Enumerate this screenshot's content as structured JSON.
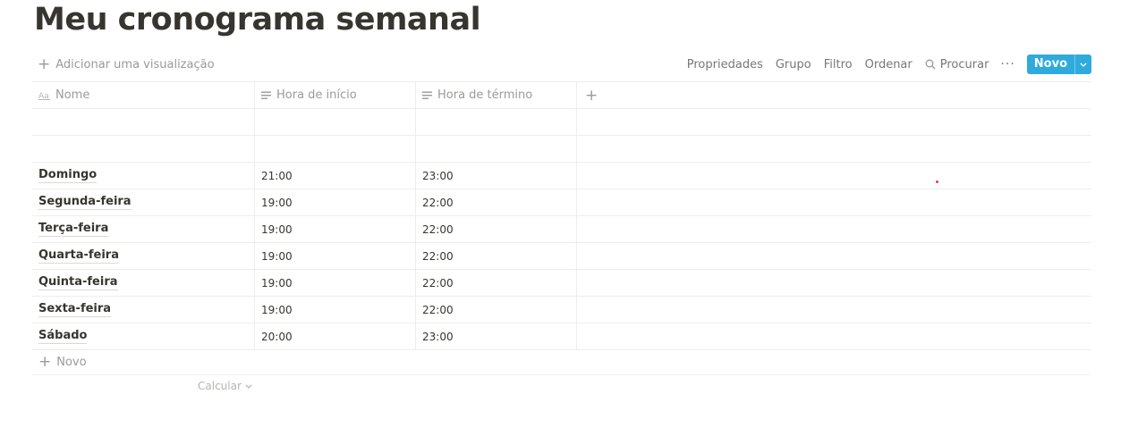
{
  "page": {
    "title": "Meu cronograma semanal"
  },
  "toolbar": {
    "add_view_label": "Adicionar uma visualização",
    "properties_label": "Propriedades",
    "group_label": "Grupo",
    "filter_label": "Filtro",
    "sort_label": "Ordenar",
    "search_label": "Procurar",
    "more_label": "···",
    "new_label": "Novo",
    "accent_color": "#2eaadc"
  },
  "table": {
    "columns": [
      {
        "label": "Nome",
        "icon": "title-icon"
      },
      {
        "label": "Hora de início",
        "icon": "text-icon"
      },
      {
        "label": "Hora de término",
        "icon": "text-icon"
      }
    ],
    "add_column_label": "+",
    "rows": [
      {
        "name": "",
        "start": "",
        "end": ""
      },
      {
        "name": "",
        "start": "",
        "end": ""
      },
      {
        "name": "Domingo",
        "start": "21:00",
        "end": "23:00"
      },
      {
        "name": "Segunda-feira",
        "start": "19:00",
        "end": "22:00"
      },
      {
        "name": "Terça-feira",
        "start": "19:00",
        "end": "22:00"
      },
      {
        "name": "Quarta-feira",
        "start": "19:00",
        "end": "22:00"
      },
      {
        "name": "Quinta-feira",
        "start": "19:00",
        "end": "22:00"
      },
      {
        "name": "Sexta-feira",
        "start": "19:00",
        "end": "22:00"
      },
      {
        "name": "Sábado",
        "start": "20:00",
        "end": "23:00"
      }
    ],
    "add_row_label": "Novo",
    "calculate_label": "Calcular"
  }
}
